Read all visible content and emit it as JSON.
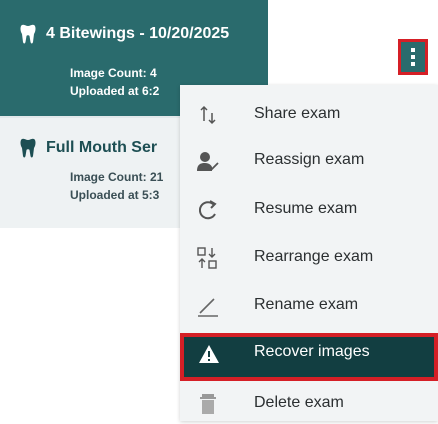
{
  "exams": [
    {
      "title": "4 Bitewings - 10/20/2025",
      "image_count": "Image Count: 4",
      "uploaded": "Uploaded at 6:2"
    },
    {
      "title": "Full Mouth Ser",
      "image_count": "Image Count: 21",
      "uploaded": "Uploaded at 5:3"
    }
  ],
  "menu": {
    "items": [
      {
        "label": "Share exam",
        "icon": "share-sort-icon"
      },
      {
        "label": "Reassign exam",
        "icon": "reassign-user-icon"
      },
      {
        "label": "Resume exam",
        "icon": "resume-rotate-icon"
      },
      {
        "label": "Rearrange exam",
        "icon": "rearrange-icon"
      },
      {
        "label": "Rename exam",
        "icon": "pencil-icon"
      },
      {
        "label": "Recover images",
        "icon": "warning-icon",
        "highlighted": true
      },
      {
        "label": "Delete exam",
        "icon": "trash-icon"
      }
    ]
  },
  "colors": {
    "selected_card": "#2a6b6d",
    "highlight_border": "#d51f26",
    "active_menu_item": "#123e41"
  }
}
